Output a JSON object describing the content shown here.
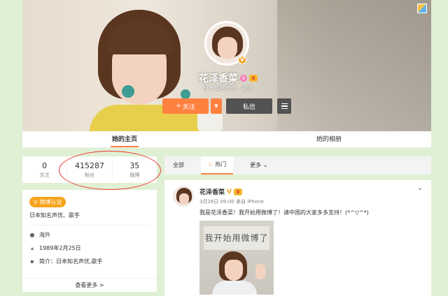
{
  "profile": {
    "name": "花泽香菜",
    "description": "日本知名声优、歌手",
    "gender_icon": "female-icon",
    "verified_badge": "V",
    "follow_label": "关注",
    "follow_plus": "+",
    "message_label": "私信",
    "colors": {
      "accent": "#ff8140",
      "dark_button": "#525252",
      "verified": "#f2a11f"
    }
  },
  "tabs": {
    "home": "她的主页",
    "album": "她的相册"
  },
  "stats": [
    {
      "value": "0",
      "label": "关注"
    },
    {
      "value": "415287",
      "label": "粉丝"
    },
    {
      "value": "35",
      "label": "微博"
    }
  ],
  "info": {
    "verify_badge": "微博认证",
    "verify_text": "日本知名声优、歌手",
    "location": "海外",
    "birthday": "1989年2月25日",
    "bio": "简介：日本知名声优,歌手",
    "view_more": "查看更多 >"
  },
  "feed_tabs": {
    "all": "全部",
    "hot": "热门",
    "more": "更多 ⌄"
  },
  "post": {
    "author": "花泽香菜",
    "meta": "3月28日 09:00 来自 iPhone",
    "text": "我是花泽香菜！我开始用微博了！请中国的大家多多支持！(*^▽^*)",
    "image_caption": "我开始用微博了"
  }
}
